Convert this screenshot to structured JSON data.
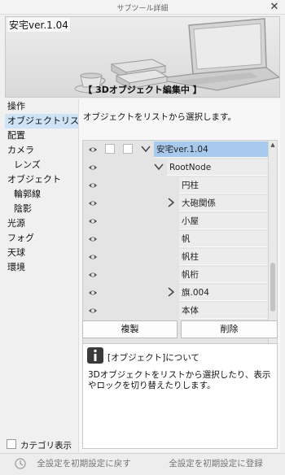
{
  "window": {
    "title": "サブツール詳細",
    "close_label": "✕"
  },
  "banner": {
    "version_text": "安宅ver.1.04",
    "mode_text": "【 3Dオブジェクト編集中 】"
  },
  "nav": {
    "items": [
      {
        "label": "操作"
      },
      {
        "label": "オブジェクトリスト"
      },
      {
        "label": "配置"
      },
      {
        "label": "カメラ"
      },
      {
        "label": "レンズ"
      },
      {
        "label": "オブジェクト"
      },
      {
        "label": "輪郭線"
      },
      {
        "label": "陰影"
      },
      {
        "label": "光源"
      },
      {
        "label": "フォグ"
      },
      {
        "label": "天球"
      },
      {
        "label": "環境"
      }
    ],
    "active": "オブジェクトリスト"
  },
  "panel": {
    "description": "オブジェクトをリストから選択します。"
  },
  "tree": {
    "rows": [
      {
        "label": "安宅ver.1.04"
      },
      {
        "label": "RootNode"
      },
      {
        "label": "円柱"
      },
      {
        "label": "大砲関係"
      },
      {
        "label": "小屋"
      },
      {
        "label": "帆"
      },
      {
        "label": "帆柱"
      },
      {
        "label": "帆桁"
      },
      {
        "label": "旗.004"
      },
      {
        "label": "本体"
      }
    ]
  },
  "buttons": {
    "duplicate": "複製",
    "delete": "削除"
  },
  "info": {
    "title": "[オブジェクト]について",
    "body": "3Dオブジェクトをリストから選択したり、表示やロックを切り替えたりします。"
  },
  "category_toggle": {
    "label": "カテゴリ表示",
    "checked": false
  },
  "footer": {
    "reset_label": "全設定を初期設定に戻す",
    "register_label": "全設定を初期設定に登録"
  },
  "colors": {
    "selection": "#a7c9ee",
    "nav_active": "#cfe3f7"
  }
}
